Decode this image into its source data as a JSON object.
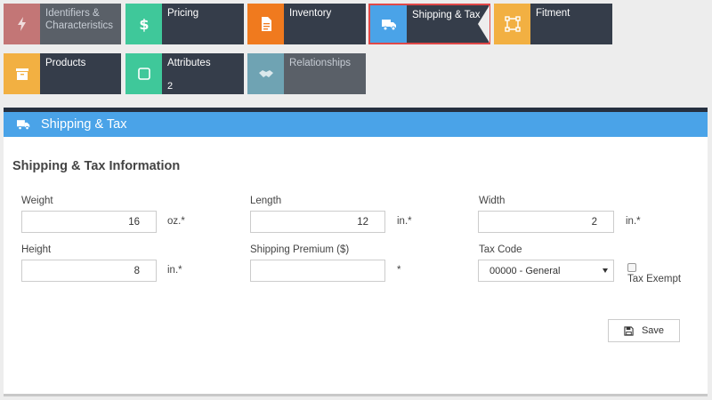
{
  "tiles": [
    {
      "label": "Identifiers & Characteristics",
      "icon": "bolt-icon",
      "color": "#cc7a7a"
    },
    {
      "label": "Pricing",
      "icon": "dollar-icon",
      "color": "#3fc89a"
    },
    {
      "label": "Inventory",
      "icon": "document-icon",
      "color": "#f07a1e"
    },
    {
      "label": "Shipping & Tax",
      "icon": "truck-icon",
      "color": "#4aa3e8"
    },
    {
      "label": "Fitment",
      "icon": "connection-icon",
      "color": "#f2b042"
    },
    {
      "label": "Products",
      "icon": "archive-icon",
      "color": "#f2b042"
    },
    {
      "label": "Attributes",
      "icon": "square-icon",
      "color": "#3fc89a",
      "count": "2"
    },
    {
      "label": "Relationships",
      "icon": "handshake-icon",
      "color": "#6fa3b3"
    }
  ],
  "panel": {
    "title": "Shipping & Tax",
    "section_title": "Shipping & Tax Information"
  },
  "form": {
    "weight": {
      "label": "Weight",
      "value": "16",
      "unit": "oz.*"
    },
    "length": {
      "label": "Length",
      "value": "12",
      "unit": "in.*"
    },
    "width": {
      "label": "Width",
      "value": "2",
      "unit": "in.*"
    },
    "height": {
      "label": "Height",
      "value": "8",
      "unit": "in.*"
    },
    "shipping_premium": {
      "label": "Shipping Premium ($)",
      "value": "",
      "unit": "*"
    },
    "tax_code": {
      "label": "Tax Code",
      "selected": "00000 - General"
    },
    "tax_exempt": {
      "label": "Tax Exempt",
      "checked": false
    }
  },
  "save_label": "Save"
}
